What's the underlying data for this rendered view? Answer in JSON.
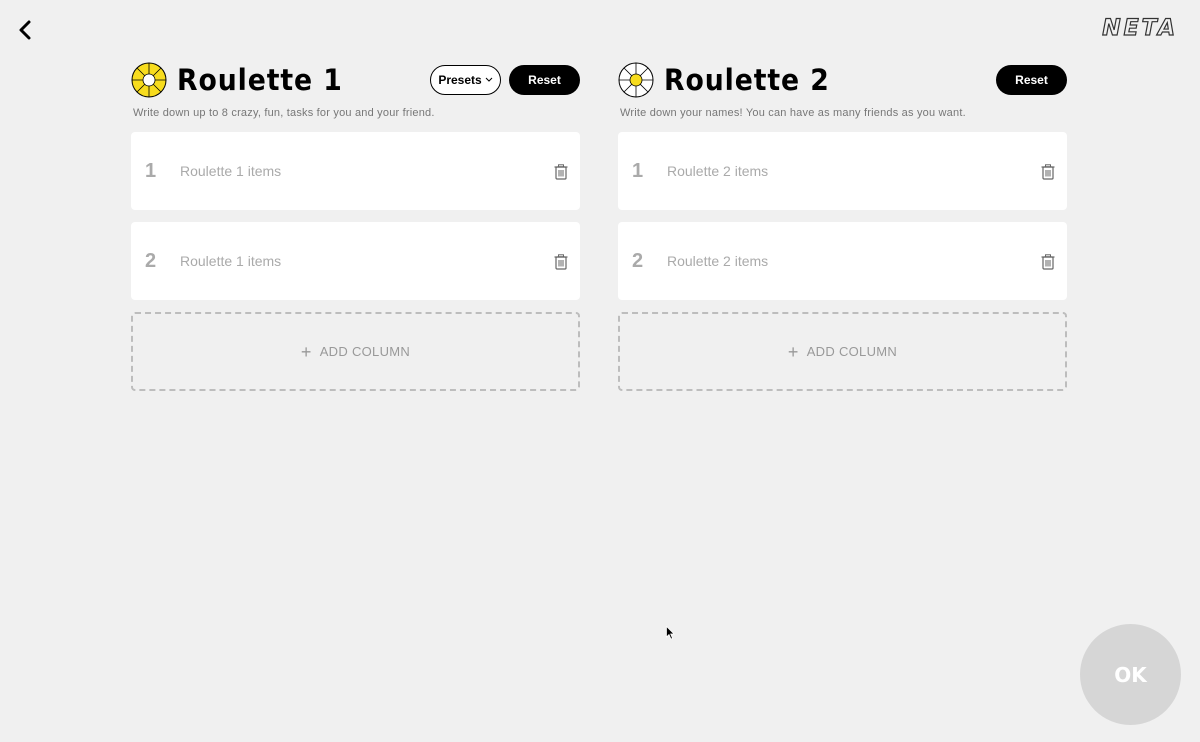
{
  "header": {
    "logo": "NETA",
    "back_icon": "chevron-left-icon"
  },
  "roulette1": {
    "title": "Roulette 1",
    "presets_label": "Presets",
    "reset_label": "Reset",
    "description": "Write down up to 8 crazy, fun, tasks for you and your friend.",
    "wheel_color": "#f7dc1e",
    "items": [
      {
        "number": "1",
        "placeholder": "Roulette 1 items",
        "value": ""
      },
      {
        "number": "2",
        "placeholder": "Roulette 1 items",
        "value": ""
      }
    ],
    "add_label": "ADD COLUMN"
  },
  "roulette2": {
    "title": "Roulette 2",
    "reset_label": "Reset",
    "description": "Write down your names! You can have as many friends as you want.",
    "wheel_color": "#ffffff",
    "wheel_center_color": "#f7dc1e",
    "items": [
      {
        "number": "1",
        "placeholder": "Roulette 2 items",
        "value": ""
      },
      {
        "number": "2",
        "placeholder": "Roulette 2 items",
        "value": ""
      }
    ],
    "add_label": "ADD COLUMN"
  },
  "ok_label": "OK",
  "colors": {
    "background": "#f0f0f0",
    "accent": "#f7dc1e",
    "ok_button": "#d6d6d6"
  }
}
